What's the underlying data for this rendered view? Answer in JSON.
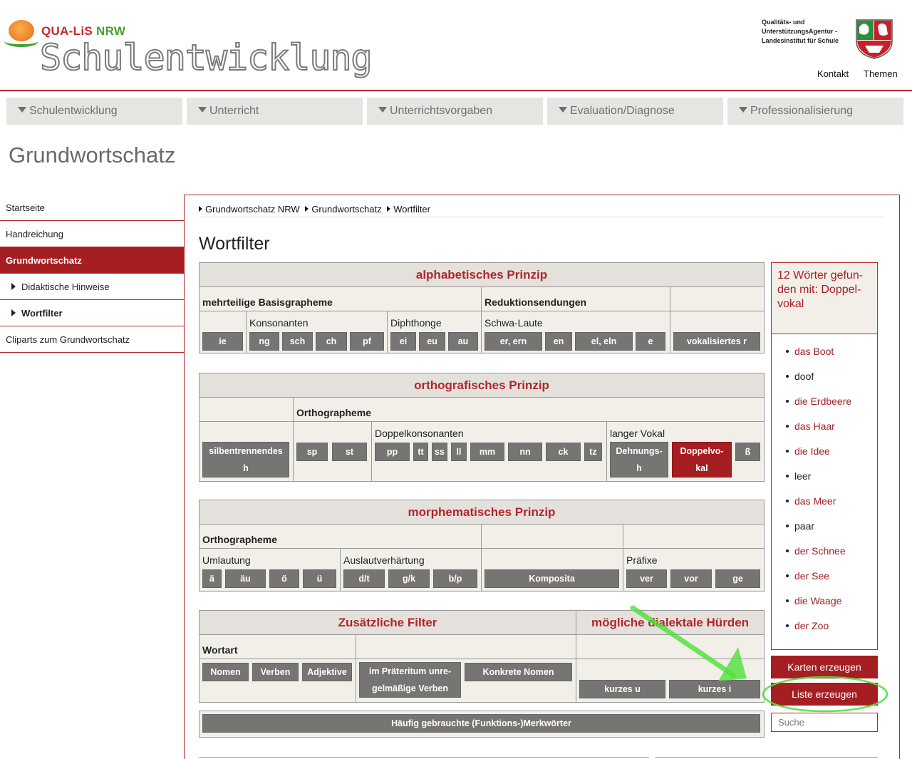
{
  "header": {
    "logo_prefix": "QUA-LiS ",
    "logo_suffix": "NRW",
    "site_title": "Schulentwicklung",
    "agency_line1": "Qualitäts- und",
    "agency_line2": "UnterstützungsAgentur -",
    "agency_line3": "Landesinstitut für Schule",
    "kontakt": "Kontakt",
    "themen": "Themen"
  },
  "menu": [
    "Schulentwicklung",
    "Unterricht",
    "Unterrichtsvorgaben",
    "Evaluation/Diagnose",
    "Professionalisierung"
  ],
  "page_title": "Grundwortschatz",
  "sidebar": {
    "items": [
      "Startseite",
      "Handreichung",
      "Grundwortschatz",
      "Didaktische Hinweise",
      "Wortfilter",
      "Cliparts zum Grundwortschatz"
    ]
  },
  "breadcrumb": [
    "Grundwortschatz NRW",
    "Grundwortschatz",
    "Wortfilter"
  ],
  "wortfilter_title": "Wortfilter",
  "alphabetisch": {
    "title": "alphabetisches Prinzip",
    "basisgrapheme": "mehrteilige Basisgrapheme",
    "reduktion": "Reduktionsendungen",
    "konsonanten": "Konsonanten",
    "diphthonge": "Diphthonge",
    "schwa": "Schwa-Laute",
    "buttons": [
      "ie",
      "ng",
      "sch",
      "ch",
      "pf",
      "ei",
      "eu",
      "au",
      "er, ern",
      "en",
      "el, eln",
      "e",
      "vokalisiertes r"
    ]
  },
  "orthografisch": {
    "title": "orthografisches Prinzip",
    "orthographeme": "Orthographeme",
    "doppelkonsonanten": "Doppelkonsonanten",
    "langer_vokal": "langer Vokal",
    "silben_l1": "silbentrennendes",
    "silben_l2": "h",
    "buttons": [
      "sp",
      "st",
      "pp",
      "tt",
      "ss",
      "ll",
      "mm",
      "nn",
      "ck",
      "tz"
    ],
    "dehnung_l1": "Dehnungs-",
    "dehnung_l2": "h",
    "doppel_l1": "Doppelvo-",
    "doppel_l2": "kal",
    "sz": "ß"
  },
  "morphematisch": {
    "title": "morphematisches Prinzip",
    "orthographeme": "Orthographeme",
    "umlautung": "Umlautung",
    "auslaut": "Auslautverhärtung",
    "praefixe": "Präfixe",
    "buttons": [
      "ä",
      "äu",
      "ö",
      "ü",
      "d/t",
      "g/k",
      "b/p",
      "Komposita",
      "ver",
      "vor",
      "ge"
    ]
  },
  "zusaetzlich": {
    "title": "Zusätzliche Filter",
    "wortart": "Wortart",
    "buttons": [
      "Nomen",
      "Verben",
      "Adjektive",
      "Konkrete Nomen"
    ],
    "praeteritum_l1": "im Präteritum unre-",
    "praeteritum_l2": "gelmäßige Verben",
    "merkwoerter": "Häufig gebrauchte (Funktions-)Merkwörter"
  },
  "dialekt": {
    "title": "mögliche dialektale Hürden",
    "buttons": [
      "kurzes u",
      "kurzes i"
    ]
  },
  "result": {
    "header": "12 Wörter gefun-den mit: Doppel-vokal",
    "words": [
      {
        "text": "das Boot",
        "link": true
      },
      {
        "text": "doof",
        "link": false
      },
      {
        "text": "die Erdbeere",
        "link": true
      },
      {
        "text": "das Haar",
        "link": true
      },
      {
        "text": "die Idee",
        "link": true
      },
      {
        "text": "leer",
        "link": false
      },
      {
        "text": "das Meer",
        "link": true
      },
      {
        "text": "paar",
        "link": false
      },
      {
        "text": "der Schnee",
        "link": true
      },
      {
        "text": "der See",
        "link": true
      },
      {
        "text": "die Waage",
        "link": true
      },
      {
        "text": "der Zoo",
        "link": true
      }
    ]
  },
  "actions": {
    "karten": "Karten erzeugen",
    "liste": "Liste erzeugen"
  },
  "search": {
    "placeholder": "Suche"
  },
  "colors": {
    "brand_red": "#a51e22",
    "button_gray": "#767573",
    "panel_beige": "#f2efe9",
    "annotation_green": "#4fe03a"
  }
}
